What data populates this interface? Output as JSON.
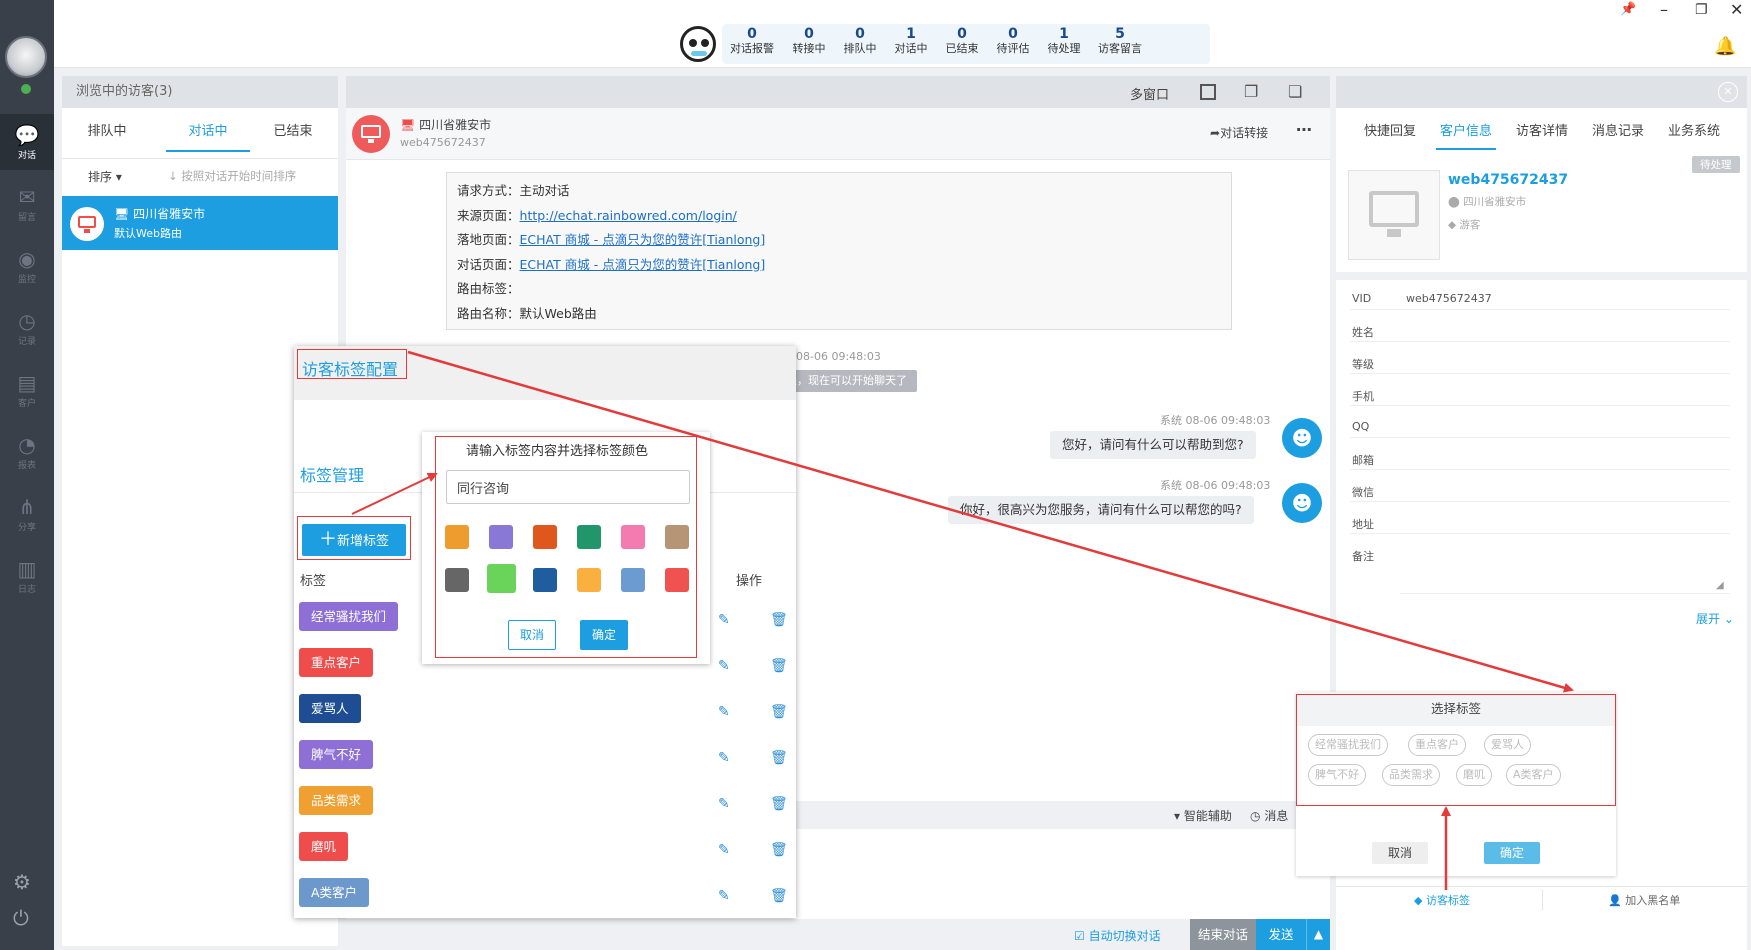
{
  "nav": {
    "items": [
      {
        "label": "对话",
        "icon": "chat-icon",
        "glyph": "💬",
        "active": true
      },
      {
        "label": "留言",
        "icon": "mail-icon",
        "glyph": "✉"
      },
      {
        "label": "监控",
        "icon": "eye-icon",
        "glyph": "◉"
      },
      {
        "label": "记录",
        "icon": "clock-icon",
        "glyph": "◷"
      },
      {
        "label": "客户",
        "icon": "contact-card-icon",
        "glyph": "▤"
      },
      {
        "label": "报表",
        "icon": "pie-chart-icon",
        "glyph": "◔"
      },
      {
        "label": "分享",
        "icon": "share-icon",
        "glyph": "⋔"
      },
      {
        "label": "日志",
        "icon": "clipboard-icon",
        "glyph": "▥"
      }
    ]
  },
  "topbar": {
    "stats": [
      {
        "n": "0",
        "l": "对话报警"
      },
      {
        "n": "0",
        "l": "转接中"
      },
      {
        "n": "0",
        "l": "排队中"
      },
      {
        "n": "1",
        "l": "对话中"
      },
      {
        "n": "0",
        "l": "已结束"
      },
      {
        "n": "0",
        "l": "待评估"
      },
      {
        "n": "1",
        "l": "待处理"
      },
      {
        "n": "5",
        "l": "访客留言"
      }
    ]
  },
  "visitors": {
    "title": "浏览中的访客(3)",
    "tabs": [
      "排队中",
      "对话中",
      "已结束"
    ],
    "sort_label": "排序",
    "sort_hint": "按照对话开始时间排序",
    "item": {
      "location": "四川省雅安市",
      "route": "默认Web路由"
    }
  },
  "chat": {
    "toolbar_label": "多窗口",
    "header_location": "四川省雅安市",
    "header_vid": "web475672437",
    "transfer_label": "对话转接",
    "info": {
      "method_label": "请求方式：",
      "method": "主动对话",
      "source_label": "来源页面：",
      "source": "http://echat.rainbowred.com/login/",
      "landing_label": "落地页面：",
      "landing": "ECHAT 商城 - 点滴只为您的赞许[Tianlong]",
      "dialog_label": "对话页面：",
      "dialog": "ECHAT 商城 - 点滴只为您的赞许[Tianlong]",
      "route_tag_label": "路由标签：",
      "route_name_label": "路由名称：",
      "route_name": "默认Web路由"
    },
    "time1": "08-06 09:48:03",
    "notice": "通，现在可以开始聊天了",
    "msg1_meta": "系统 08-06 09:48:03",
    "msg1": "您好，请问有什么可以帮助到您?",
    "msg2_meta": "系统 08-06 09:48:03",
    "msg2": "你好，很高兴为您服务，请问有什么可以帮您的吗?",
    "assist_label": "智能辅助",
    "msg_label": "消息",
    "auto_switch": "自动切换对话",
    "end_label": "结束对话",
    "send_label": "发送"
  },
  "tagconfig": {
    "title": "访客标签配置",
    "manage_label": "标签管理",
    "add_label": "新增标签",
    "col_tag": "标签",
    "col_op": "操作",
    "tags": [
      {
        "name": "经常骚扰我们",
        "color": "#8e6fd6"
      },
      {
        "name": "重点客户",
        "color": "#ef4c4c"
      },
      {
        "name": "爱骂人",
        "color": "#1f4d93"
      },
      {
        "name": "脾气不好",
        "color": "#8e6fd6"
      },
      {
        "name": "品类需求",
        "color": "#f0a030"
      },
      {
        "name": "磨叽",
        "color": "#ef4c4c"
      },
      {
        "name": "A类客户",
        "color": "#6d98cc"
      }
    ]
  },
  "newtag": {
    "prompt": "请输入标签内容并选择标签颜色",
    "value": "同行咨询",
    "colors": [
      "#ef9c2e",
      "#8a78d6",
      "#e0571e",
      "#20966a",
      "#f37bb0",
      "#b69576",
      "#666666",
      "#6ad45a",
      "#1f5d9e",
      "#f9b040",
      "#6b9bd0",
      "#f05252"
    ],
    "cancel": "取消",
    "ok": "确定"
  },
  "right": {
    "tabs": [
      "快捷回复",
      "客户信息",
      "访客详情",
      "消息记录",
      "业务系统"
    ],
    "badge": "待处理",
    "vid_title": "web475672437",
    "location": "四川省雅安市",
    "type": "游客",
    "fields": [
      {
        "label": "VID",
        "value": "web475672437"
      },
      {
        "label": "姓名",
        "value": ""
      },
      {
        "label": "等级",
        "value": ""
      },
      {
        "label": "手机",
        "value": ""
      },
      {
        "label": "QQ",
        "value": ""
      },
      {
        "label": "邮箱",
        "value": ""
      },
      {
        "label": "微信",
        "value": ""
      },
      {
        "label": "地址",
        "value": ""
      },
      {
        "label": "备注",
        "value": ""
      }
    ],
    "expand": "展开",
    "select": {
      "title": "选择标签",
      "pills": [
        "经常骚扰我们",
        "重点客户",
        "爱骂人",
        "脾气不好",
        "品类需求",
        "磨叽",
        "A类客户"
      ],
      "cancel": "取消",
      "ok": "确定"
    },
    "visitor_tag": "访客标签",
    "blacklist": "加入黑名单"
  }
}
